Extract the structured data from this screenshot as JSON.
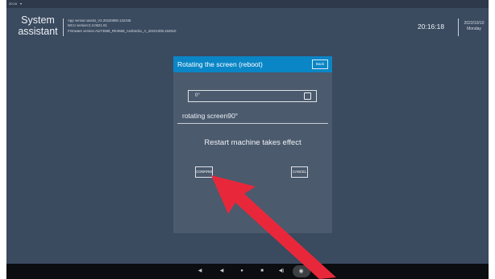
{
  "statusbar": {
    "time": "20:16",
    "icon": "notification-icon"
  },
  "header": {
    "app_title": "System assistant",
    "app_version": "App version:assist_V2.20220808.132345",
    "mcu_version": "MCU version:2.3.0621.01",
    "firmware_version": "Firmware version:AioT3568_RK3568_Android11_A_20221008.152910",
    "time": "20:16:18",
    "date": "2022/10/10",
    "weekday": "Monday"
  },
  "dialog": {
    "title": "Rotating the screen (reboot)",
    "back_label": "Back",
    "select_value": "0°",
    "option_label": "rotating screen90°",
    "notice": "Restart machine takes effect",
    "confirm_label": "CONFIRM",
    "cancel_label": "CANCEL"
  },
  "navbar": {
    "icons": [
      "volume-down-icon",
      "back-icon",
      "home-icon",
      "recent-apps-icon",
      "volume-up-icon",
      "screenshot-icon"
    ]
  },
  "colors": {
    "background": "#3a4a5f",
    "dialog": "#4b5a6d",
    "titlebar": "#0a86c6",
    "arrow": "#e8283a",
    "navbar": "#0b0d10"
  }
}
